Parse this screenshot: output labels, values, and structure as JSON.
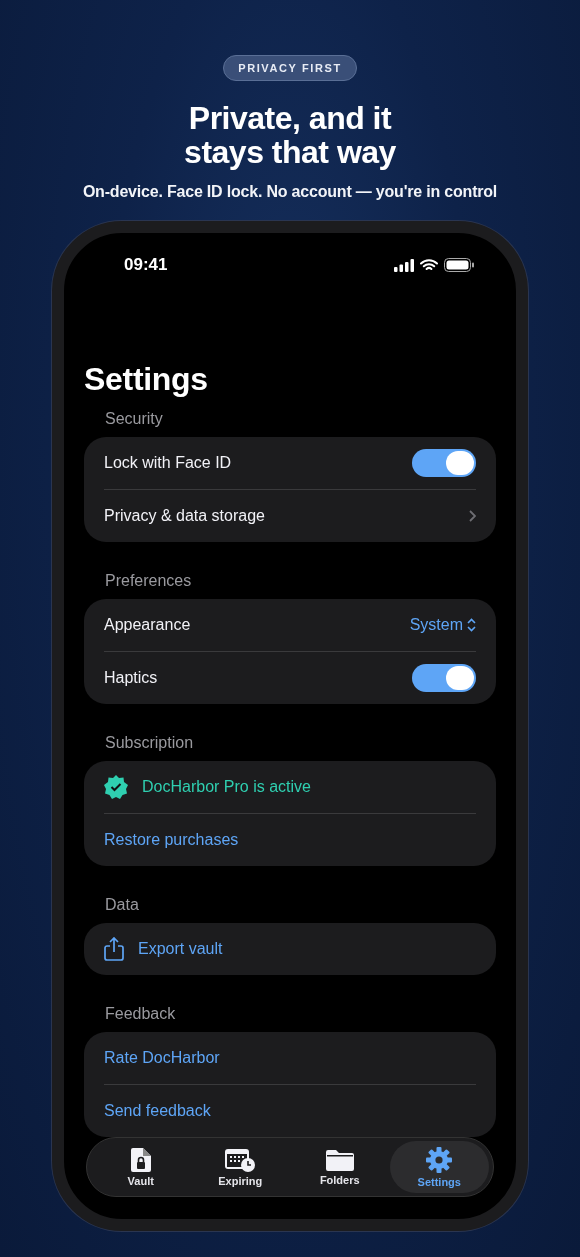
{
  "header": {
    "badge": "PRIVACY FIRST",
    "title": "Private, and it\nstays that way",
    "subtitle": "On-device. Face ID lock. No account — you're in control"
  },
  "status_bar": {
    "time": "09:41"
  },
  "screen": {
    "title": "Settings",
    "sections": [
      {
        "header": "Security",
        "rows": [
          {
            "kind": "toggle",
            "label": "Lock with Face ID",
            "on": true
          },
          {
            "kind": "link",
            "label": "Privacy & data storage"
          }
        ]
      },
      {
        "header": "Preferences",
        "rows": [
          {
            "kind": "picker",
            "label": "Appearance",
            "value": "System"
          },
          {
            "kind": "toggle",
            "label": "Haptics",
            "on": true
          }
        ]
      },
      {
        "header": "Subscription",
        "rows": [
          {
            "kind": "status",
            "label": "DocHarbor Pro is active"
          },
          {
            "kind": "action",
            "label": "Restore purchases"
          }
        ]
      },
      {
        "header": "Data",
        "rows": [
          {
            "kind": "export",
            "label": "Export vault"
          }
        ]
      },
      {
        "header": "Feedback",
        "rows": [
          {
            "kind": "action",
            "label": "Rate DocHarbor"
          },
          {
            "kind": "action",
            "label": "Send feedback"
          }
        ]
      }
    ]
  },
  "tab_bar": [
    {
      "label": "Vault",
      "selected": false
    },
    {
      "label": "Expiring",
      "selected": false
    },
    {
      "label": "Folders",
      "selected": false
    },
    {
      "label": "Settings",
      "selected": true
    }
  ]
}
